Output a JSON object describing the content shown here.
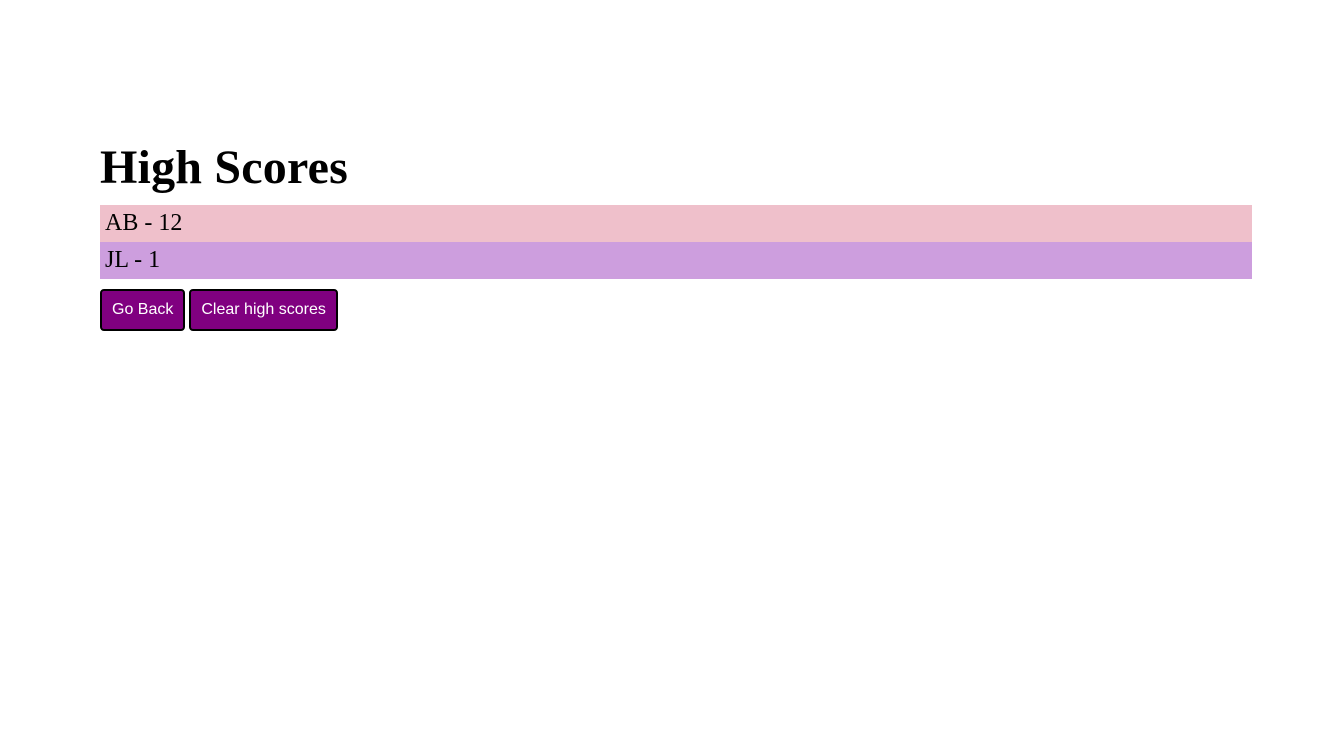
{
  "page": {
    "title": "High Scores"
  },
  "scores": [
    {
      "label": "AB - 12",
      "color": "#efc0cb"
    },
    {
      "label": "JL - 1",
      "color": "#cd9ede"
    }
  ],
  "buttons": {
    "go_back_label": "Go Back",
    "clear_label": "Clear high scores",
    "color": "#800080"
  }
}
